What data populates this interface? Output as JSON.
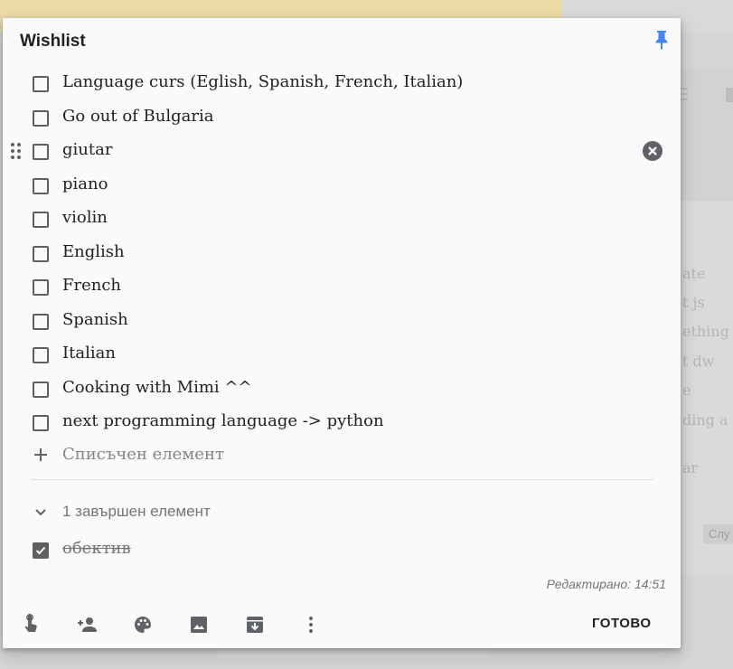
{
  "note": {
    "title": "Wishlist",
    "items": [
      {
        "text": "Language curs (Eglish, Spanish, French, Italian)",
        "checked": false
      },
      {
        "text": "Go out of Bulgaria",
        "checked": false
      },
      {
        "text": "giutar",
        "checked": false
      },
      {
        "text": "piano",
        "checked": false
      },
      {
        "text": "violin",
        "checked": false
      },
      {
        "text": "English",
        "checked": false
      },
      {
        "text": "French",
        "checked": false
      },
      {
        "text": "Spanish",
        "checked": false
      },
      {
        "text": "Italian",
        "checked": false
      },
      {
        "text": "Cooking with Mimi ^^",
        "checked": false
      },
      {
        "text": "next programming language -> python",
        "checked": false
      }
    ],
    "add_item_placeholder": "Списъчен елемент",
    "completed_header": "1 завършен елемент",
    "completed_items": [
      {
        "text": "обектив",
        "checked": true
      }
    ],
    "edited": "Редактирано: 14:51",
    "done_label": "ГОТОВО"
  },
  "toolbar": {
    "icons": [
      "remind-me-icon",
      "collaborator-icon",
      "palette-icon",
      "image-icon",
      "archive-icon",
      "more-icon"
    ]
  },
  "background": {
    "snippets": [
      "ate",
      "t js",
      "ething",
      "t dw",
      "e",
      "ding a",
      "ar"
    ],
    "badge": "Слу"
  },
  "colors": {
    "pin": "#4285f4",
    "checkbox": "#5f5f5f",
    "top_strip": "#ebdba7"
  }
}
